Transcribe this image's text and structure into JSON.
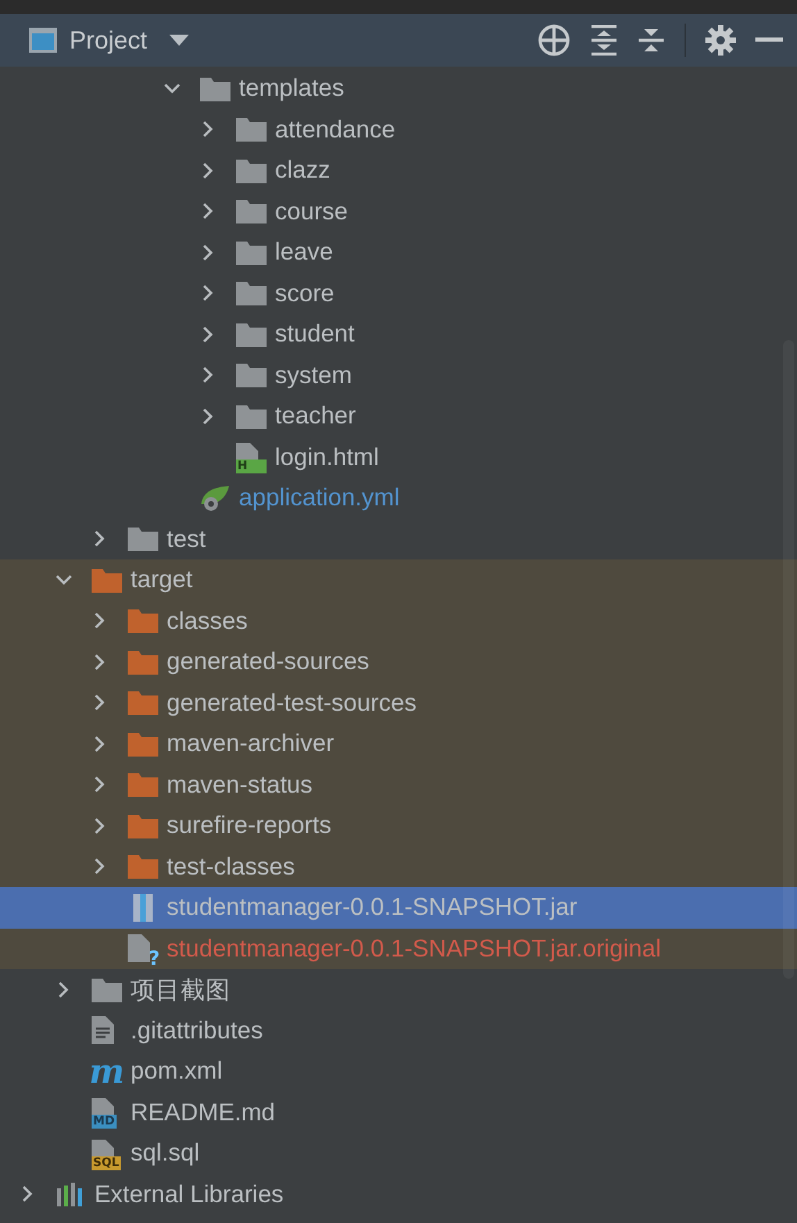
{
  "panel": {
    "title": "Project"
  },
  "tree": [
    {
      "children": [
        {
          "children": [
            {
              "children": [
                {
                  "children": [
                    {
                      "label": "templates",
                      "kind": "folder",
                      "expanded": true,
                      "excluded": false,
                      "selected": false,
                      "children": [
                        {
                          "label": "attendance",
                          "kind": "folder",
                          "expanded": false,
                          "excluded": false,
                          "selected": false
                        },
                        {
                          "label": "clazz",
                          "kind": "folder",
                          "expanded": false,
                          "excluded": false,
                          "selected": false
                        },
                        {
                          "label": "course",
                          "kind": "folder",
                          "expanded": false,
                          "excluded": false,
                          "selected": false
                        },
                        {
                          "label": "leave",
                          "kind": "folder",
                          "expanded": false,
                          "excluded": false,
                          "selected": false
                        },
                        {
                          "label": "score",
                          "kind": "folder",
                          "expanded": false,
                          "excluded": false,
                          "selected": false
                        },
                        {
                          "label": "student",
                          "kind": "folder",
                          "expanded": false,
                          "excluded": false,
                          "selected": false
                        },
                        {
                          "label": "system",
                          "kind": "folder",
                          "expanded": false,
                          "excluded": false,
                          "selected": false
                        },
                        {
                          "label": "teacher",
                          "kind": "folder",
                          "expanded": false,
                          "excluded": false,
                          "selected": false
                        },
                        {
                          "label": "login.html",
                          "kind": "html",
                          "badge": "H",
                          "excluded": false,
                          "selected": false
                        }
                      ]
                    },
                    {
                      "label": "application.yml",
                      "kind": "yml",
                      "color": "#5394d0",
                      "excluded": false,
                      "selected": false
                    }
                  ]
                }
              ]
            },
            {
              "label": "test",
              "kind": "folder",
              "expanded": false,
              "excluded": false,
              "selected": false
            }
          ]
        },
        {
          "label": "target",
          "kind": "folder",
          "expanded": true,
          "excluded": true,
          "selected": false,
          "children": [
            {
              "label": "classes",
              "kind": "folder",
              "expanded": false,
              "excluded": true,
              "selected": false
            },
            {
              "label": "generated-sources",
              "kind": "folder",
              "expanded": false,
              "excluded": true,
              "selected": false
            },
            {
              "label": "generated-test-sources",
              "kind": "folder",
              "expanded": false,
              "excluded": true,
              "selected": false
            },
            {
              "label": "maven-archiver",
              "kind": "folder",
              "expanded": false,
              "excluded": true,
              "selected": false
            },
            {
              "label": "maven-status",
              "kind": "folder",
              "expanded": false,
              "excluded": true,
              "selected": false
            },
            {
              "label": "surefire-reports",
              "kind": "folder",
              "expanded": false,
              "excluded": true,
              "selected": false
            },
            {
              "label": "test-classes",
              "kind": "folder",
              "expanded": false,
              "excluded": true,
              "selected": false
            },
            {
              "label": "studentmanager-0.0.1-SNAPSHOT.jar",
              "kind": "jar",
              "excluded": true,
              "selected": true
            },
            {
              "label": "studentmanager-0.0.1-SNAPSHOT.jar.original",
              "kind": "unknown",
              "badge": "?",
              "color": "#d25a4b",
              "excluded": true,
              "selected": false
            }
          ]
        },
        {
          "label": "项目截图",
          "kind": "folder",
          "expanded": false,
          "excluded": false,
          "selected": false
        },
        {
          "label": ".gitattributes",
          "kind": "text",
          "excluded": false,
          "selected": false
        },
        {
          "label": "pom.xml",
          "kind": "maven",
          "badge": "m",
          "excluded": false,
          "selected": false
        },
        {
          "label": "README.md",
          "kind": "markdown",
          "badge": "MD",
          "excluded": false,
          "selected": false
        },
        {
          "label": "sql.sql",
          "kind": "sql",
          "badge": "SQL",
          "excluded": false,
          "selected": false
        }
      ]
    },
    {
      "label": "External Libraries",
      "kind": "libraries",
      "expanded": false,
      "excluded": false,
      "selected": false
    }
  ]
}
